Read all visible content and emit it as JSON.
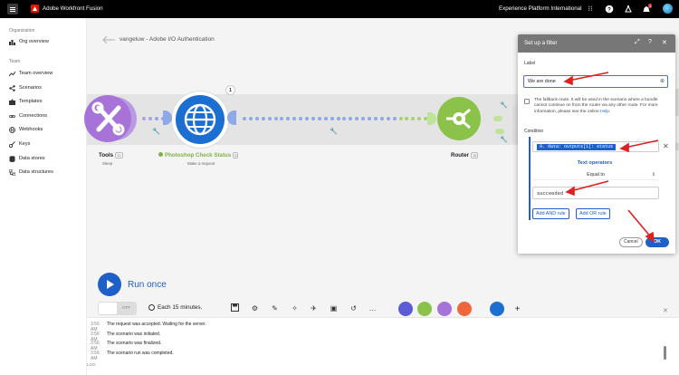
{
  "topbar": {
    "app_title": "Adobe Workfront Fusion",
    "org_name": "Experience Platform International",
    "notification_count": "1"
  },
  "sidebar": {
    "org_section": "Organization",
    "org_items": [
      {
        "label": "Org overview",
        "icon": "bar-chart-icon"
      }
    ],
    "team_section": "Team",
    "team_items": [
      {
        "label": "Team overview",
        "icon": "trend-icon"
      },
      {
        "label": "Scenarios",
        "icon": "share-icon"
      },
      {
        "label": "Templates",
        "icon": "puzzle-icon"
      },
      {
        "label": "Connections",
        "icon": "link-icon"
      },
      {
        "label": "Webhooks",
        "icon": "globe-icon"
      },
      {
        "label": "Keys",
        "icon": "key-icon"
      },
      {
        "label": "Data stores",
        "icon": "database-icon"
      },
      {
        "label": "Data structures",
        "icon": "structure-icon"
      }
    ]
  },
  "scenario": {
    "title": "vangeluw - Adobe I/O Authentication",
    "nodes": [
      {
        "label": "Tools",
        "count": "10",
        "sub": "Sleep"
      },
      {
        "label": "Photoshop Check Status",
        "count": "8",
        "sub": "Make a request",
        "badge": "1"
      },
      {
        "label": "Router",
        "count": "16",
        "sub": ""
      }
    ]
  },
  "dialog": {
    "title": "Set up a filter",
    "label_caption": "Label",
    "label_value": "We are done",
    "fallback_text": "The fallback route. It will be used in the scenario where a bundle cannot continue on from the router via any other route. For more information, please see the online",
    "fallback_link": "Help",
    "condition_caption": "Condition",
    "condition_pill": "9. data: outputs[1]: status",
    "operators_title": "Text operators",
    "operator_value": "Equal to",
    "compare_value": "succeeded",
    "and_rule": "Add AND rule",
    "or_rule": "Add OR rule",
    "cancel": "Cancel",
    "ok": "OK"
  },
  "toolbar": {
    "run_once": "Run once",
    "toggle_state": "OFF",
    "schedule": "Each 15 minutes."
  },
  "log": {
    "entries": [
      {
        "time": "3:56 AM",
        "message": "The request was accepted. Waiting for the server."
      },
      {
        "time": "3:56 AM",
        "message": "The scenario was initiated."
      },
      {
        "time": "3:56 AM",
        "message": "The scenario was finalized."
      },
      {
        "time": "3:56 AM",
        "message": "The scenario run was completed."
      }
    ],
    "footer": "LOG"
  },
  "colors": {
    "accent": "#1f5fc8",
    "tools_node": "#a873d9",
    "http_node": "#1c6fd1",
    "router_node": "#8bc34a",
    "annotation": "#e02020"
  }
}
